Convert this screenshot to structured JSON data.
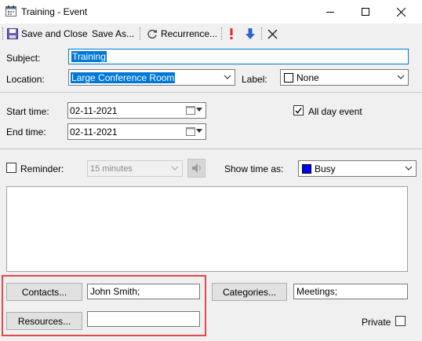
{
  "window": {
    "title": "Training - Event",
    "icons": {
      "app": "calendar-icon",
      "minimize": "minimize-icon",
      "maximize": "maximize-icon",
      "close": "close-icon"
    }
  },
  "toolbar": {
    "save_close_label": "Save and Close",
    "save_as_label": "Save As...",
    "recurrence_label": "Recurrence...",
    "icons": {
      "save": "floppy-disk-icon",
      "recurrence": "recurrence-icon",
      "importance_high": "exclamation-icon",
      "importance_low": "down-arrow-icon",
      "delete": "delete-x-icon"
    }
  },
  "form": {
    "subject_label": "Subject:",
    "subject_value": "Training",
    "location_label": "Location:",
    "location_value": "Large Conference Room",
    "label_label": "Label:",
    "label_value": "None",
    "start_label": "Start time:",
    "start_value": "02-11-2021",
    "end_label": "End time:",
    "end_value": "02-11-2021",
    "all_day_label": "All day event",
    "all_day_checked": true,
    "reminder_label": "Reminder:",
    "reminder_checked": false,
    "reminder_value": "15 minutes",
    "show_time_label": "Show time as:",
    "show_time_value": "Busy",
    "show_time_color": "#0000ff",
    "notes_value": ""
  },
  "footer": {
    "contacts_button": "Contacts...",
    "contacts_value": "John Smith;",
    "resources_button": "Resources...",
    "resources_value": "",
    "categories_button": "Categories...",
    "categories_value": "Meetings;",
    "private_label": "Private",
    "private_checked": false
  },
  "colors": {
    "selection": "#0078d7",
    "highlight_frame": "#e8474b"
  }
}
